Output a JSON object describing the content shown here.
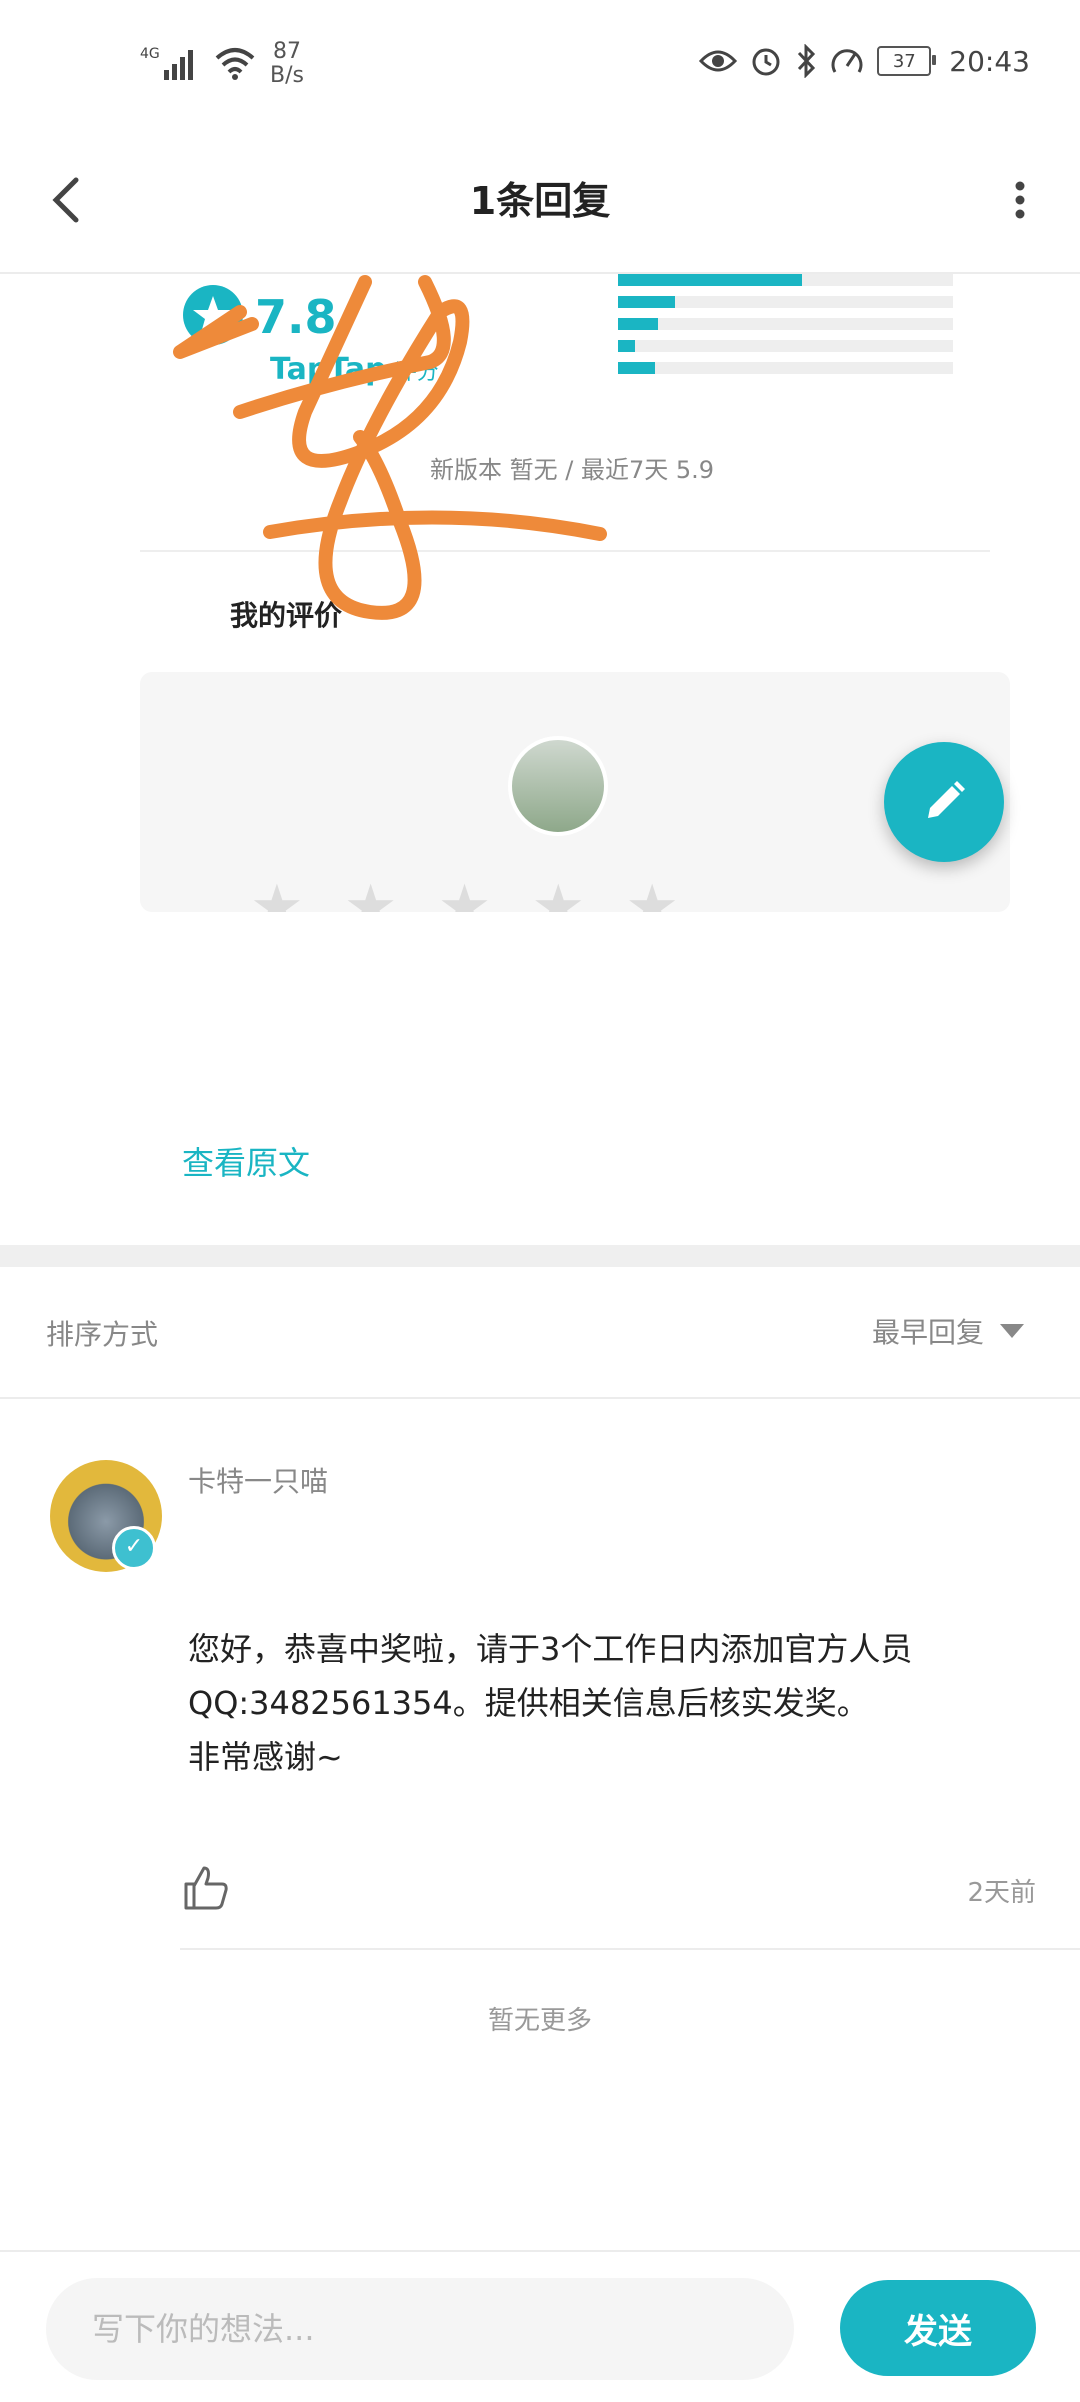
{
  "status_bar": {
    "network": "4G",
    "speed_value": "87",
    "speed_unit": "B/s",
    "battery": "37",
    "time": "20:43",
    "icons": [
      "signal-icon",
      "wifi-icon",
      "eye-icon",
      "alarm-icon",
      "bluetooth-icon",
      "speedometer-icon",
      "battery-icon"
    ]
  },
  "header": {
    "title": "1条回复"
  },
  "attachment": {
    "score": "7.8",
    "brand": "TapTap",
    "brand_suffix": "评分",
    "version_text": "新版本 暂无 / 最近7天 5.9",
    "my_review_label": "我的评价",
    "rating_bars": [
      0.55,
      0.17,
      0.12,
      0.05,
      0.11
    ]
  },
  "view_original": "查看原文",
  "sort": {
    "label": "排序方式",
    "value": "最早回复"
  },
  "comment": {
    "author": "卡特一只喵",
    "lines": [
      "您好，恭喜中奖啦，请于3个工作日内添加官方人员",
      "QQ:3482561354。提供相关信息后核实发奖。",
      "非常感谢~"
    ],
    "time": "2天前"
  },
  "no_more": "暂无更多",
  "compose": {
    "placeholder": "写下你的想法...",
    "send_label": "发送"
  },
  "colors": {
    "accent": "#1ab5c3",
    "scribble": "#ee8a3a"
  }
}
